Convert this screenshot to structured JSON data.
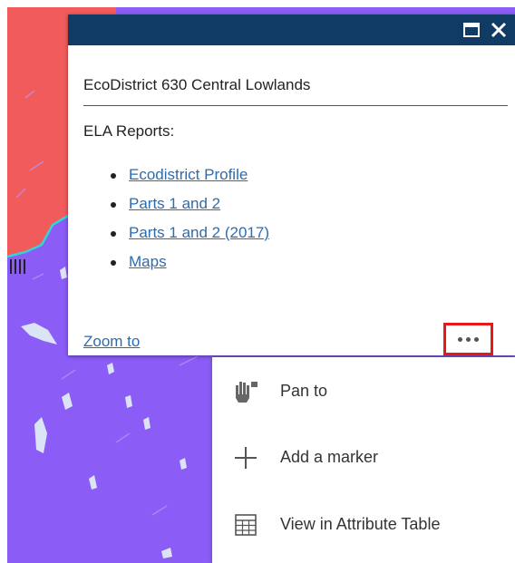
{
  "colors": {
    "header": "#0f3b64",
    "map_purple": "#8b5cf6",
    "map_red": "#f25b5b",
    "boundary": "#2fd6d6",
    "link": "#2b6cb0",
    "highlight_border": "#e81818"
  },
  "popup": {
    "header_icons": [
      "maximize-icon",
      "close-icon"
    ],
    "title": "EcoDistrict 630 Central Lowlands",
    "reports_label": "ELA Reports:",
    "links": [
      {
        "label": "Ecodistrict Profile"
      },
      {
        "label": "Parts 1 and 2"
      },
      {
        "label": "Parts 1 and 2 (2017)"
      },
      {
        "label": "Maps"
      }
    ],
    "zoom_label": "Zoom to",
    "more_icon": "ellipsis-icon"
  },
  "actions_menu": {
    "items": [
      {
        "label": "Pan to",
        "icon": "pan-hand-icon"
      },
      {
        "label": "Add a marker",
        "icon": "plus-icon"
      },
      {
        "label": "View in Attribute Table",
        "icon": "table-icon"
      }
    ]
  }
}
